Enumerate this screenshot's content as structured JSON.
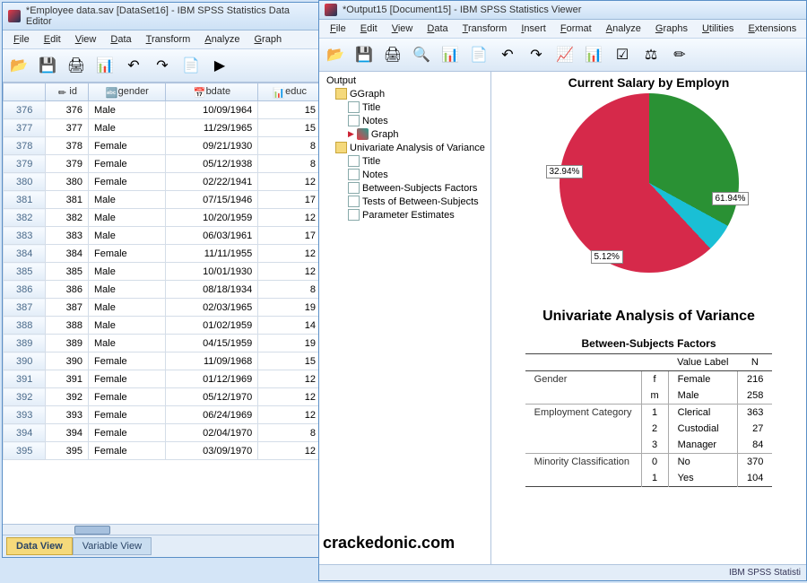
{
  "watermark": "crackedonic.com",
  "editor": {
    "title": "*Employee data.sav [DataSet16] - IBM SPSS Statistics Data Editor",
    "menus": [
      "File",
      "Edit",
      "View",
      "Data",
      "Transform",
      "Analyze",
      "Graph"
    ],
    "columns": [
      "",
      "id",
      "gender",
      "bdate",
      "educ"
    ],
    "rows": [
      {
        "n": "376",
        "id": "376",
        "gender": "Male",
        "bdate": "10/09/1964",
        "educ": "15"
      },
      {
        "n": "377",
        "id": "377",
        "gender": "Male",
        "bdate": "11/29/1965",
        "educ": "15"
      },
      {
        "n": "378",
        "id": "378",
        "gender": "Female",
        "bdate": "09/21/1930",
        "educ": "8"
      },
      {
        "n": "379",
        "id": "379",
        "gender": "Female",
        "bdate": "05/12/1938",
        "educ": "8"
      },
      {
        "n": "380",
        "id": "380",
        "gender": "Female",
        "bdate": "02/22/1941",
        "educ": "12"
      },
      {
        "n": "381",
        "id": "381",
        "gender": "Male",
        "bdate": "07/15/1946",
        "educ": "17"
      },
      {
        "n": "382",
        "id": "382",
        "gender": "Male",
        "bdate": "10/20/1959",
        "educ": "12"
      },
      {
        "n": "383",
        "id": "383",
        "gender": "Male",
        "bdate": "06/03/1961",
        "educ": "17"
      },
      {
        "n": "384",
        "id": "384",
        "gender": "Female",
        "bdate": "11/11/1955",
        "educ": "12"
      },
      {
        "n": "385",
        "id": "385",
        "gender": "Male",
        "bdate": "10/01/1930",
        "educ": "12"
      },
      {
        "n": "386",
        "id": "386",
        "gender": "Male",
        "bdate": "08/18/1934",
        "educ": "8"
      },
      {
        "n": "387",
        "id": "387",
        "gender": "Male",
        "bdate": "02/03/1965",
        "educ": "19"
      },
      {
        "n": "388",
        "id": "388",
        "gender": "Male",
        "bdate": "01/02/1959",
        "educ": "14"
      },
      {
        "n": "389",
        "id": "389",
        "gender": "Male",
        "bdate": "04/15/1959",
        "educ": "19"
      },
      {
        "n": "390",
        "id": "390",
        "gender": "Female",
        "bdate": "11/09/1968",
        "educ": "15"
      },
      {
        "n": "391",
        "id": "391",
        "gender": "Female",
        "bdate": "01/12/1969",
        "educ": "12"
      },
      {
        "n": "392",
        "id": "392",
        "gender": "Female",
        "bdate": "05/12/1970",
        "educ": "12"
      },
      {
        "n": "393",
        "id": "393",
        "gender": "Female",
        "bdate": "06/24/1969",
        "educ": "12"
      },
      {
        "n": "394",
        "id": "394",
        "gender": "Female",
        "bdate": "02/04/1970",
        "educ": "8"
      },
      {
        "n": "395",
        "id": "395",
        "gender": "Female",
        "bdate": "03/09/1970",
        "educ": "12"
      }
    ],
    "tabs": {
      "data": "Data View",
      "variable": "Variable View"
    }
  },
  "viewer": {
    "title": "*Output15 [Document15] - IBM SPSS Statistics Viewer",
    "menus": [
      "File",
      "Edit",
      "View",
      "Data",
      "Transform",
      "Insert",
      "Format",
      "Analyze",
      "Graphs",
      "Utilities",
      "Extensions"
    ],
    "outline": {
      "root": "Output",
      "ggraph": {
        "label": "GGraph",
        "children": [
          "Title",
          "Notes",
          "Graph"
        ]
      },
      "uav": {
        "label": "Univariate Analysis of Variance",
        "children": [
          "Title",
          "Notes",
          "Between-Subjects Factors",
          "Tests of Between-Subjects",
          "Parameter Estimates"
        ]
      }
    },
    "chart_title": "Current Salary by Employn",
    "pie_labels": {
      "green": "32.94%",
      "cyan": "5.12%",
      "red": "61.94%"
    },
    "analysis_heading": "Univariate Analysis of Variance",
    "bsf_title": "Between-Subjects Factors",
    "bsf_headers": {
      "vl": "Value Label",
      "n": "N"
    },
    "bsf": [
      {
        "factor": "Gender",
        "rows": [
          [
            "f",
            "Female",
            "216"
          ],
          [
            "m",
            "Male",
            "258"
          ]
        ]
      },
      {
        "factor": "Employment Category",
        "rows": [
          [
            "1",
            "Clerical",
            "363"
          ],
          [
            "2",
            "Custodial",
            "27"
          ],
          [
            "3",
            "Manager",
            "84"
          ]
        ]
      },
      {
        "factor": "Minority Classification",
        "rows": [
          [
            "0",
            "No",
            "370"
          ],
          [
            "1",
            "Yes",
            "104"
          ]
        ]
      }
    ],
    "status": "IBM SPSS Statisti"
  },
  "chart_data": {
    "type": "pie",
    "title": "Current Salary by Employment Category",
    "series": [
      {
        "name": "share",
        "values": [
          32.94,
          5.12,
          61.94
        ]
      }
    ],
    "categories": [
      "Clerical",
      "Custodial",
      "Manager"
    ],
    "labels": [
      "32.94%",
      "5.12%",
      "61.94%"
    ],
    "colors": [
      "#2a9134",
      "#1abfd5",
      "#d6294a"
    ]
  },
  "toolbar_icons": {
    "open": "📂",
    "save": "💾",
    "print": "🖨",
    "export": "📊",
    "undo": "↶",
    "redo": "↷",
    "goto": "📄",
    "zoom": "🔍",
    "run": "▶",
    "chart": "📈",
    "bars": "📊",
    "select": "☑",
    "weight": "⚖",
    "edit": "✏"
  }
}
